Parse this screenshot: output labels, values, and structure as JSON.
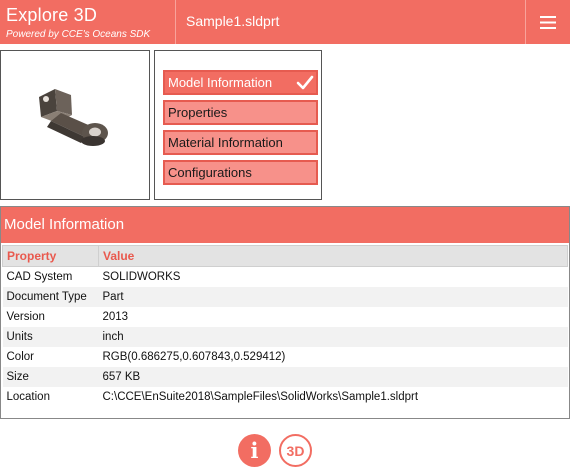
{
  "app": {
    "title": "Explore 3D",
    "subtitle": "Powered by CCE's Oceans SDK",
    "file_name": "Sample1.sldprt",
    "accent_color": "#f26d62"
  },
  "header": {
    "menu_icon": "hamburger-menu-icon"
  },
  "thumbnail": {
    "icon": "3d-part-thumbnail"
  },
  "menu": {
    "items": [
      {
        "label": "Model Information",
        "active": true
      },
      {
        "label": "Properties",
        "active": false
      },
      {
        "label": "Material Information",
        "active": false
      },
      {
        "label": "Configurations",
        "active": false
      }
    ],
    "check_icon": "checkmark-icon"
  },
  "section": {
    "title": "Model Information",
    "columns": [
      "Property",
      "Value"
    ],
    "rows": [
      {
        "property": "CAD System",
        "value": "SOLIDWORKS"
      },
      {
        "property": "Document Type",
        "value": "Part"
      },
      {
        "property": "Version",
        "value": "2013"
      },
      {
        "property": "Units",
        "value": "inch"
      },
      {
        "property": "Color",
        "value": "RGB(0.686275,0.607843,0.529412)"
      },
      {
        "property": "Size",
        "value": "657 KB"
      },
      {
        "property": "Location",
        "value": "C:\\CCE\\EnSuite2018\\SampleFiles\\SolidWorks\\Sample1.sldprt"
      }
    ]
  },
  "bottom": {
    "info_icon": "info-icon",
    "info_label": "i",
    "view3d_icon": "3d-view-icon",
    "view3d_label": "3D"
  }
}
